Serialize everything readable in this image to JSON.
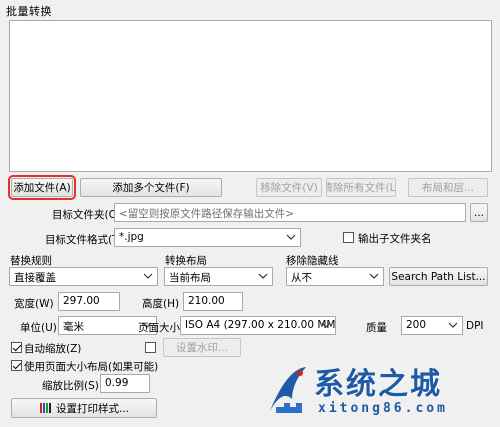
{
  "window": {
    "title": "批量转换"
  },
  "buttons": {
    "add_file": "添加文件(A)",
    "add_multiple": "添加多个文件(F)",
    "remove_file": "移除文件(V)",
    "clear_all": "清除所有文件(L)",
    "layout_layers": "布局和层...",
    "browse": "...",
    "search_path_list": "Search Path List...",
    "set_watermark": "设置水印...",
    "print_style": "设置打印样式..."
  },
  "target_folder": {
    "label": "目标文件夹(O)",
    "placeholder": "<留空则按原文件路径保存输出文件>"
  },
  "target_format": {
    "label": "目标文件格式(T)",
    "value": "*.jpg"
  },
  "output_subfolder": {
    "label": "输出子文件夹名",
    "checked": false
  },
  "replace_rule": {
    "label": "替换规则",
    "value": "直接覆盖"
  },
  "convert_layout": {
    "label": "转换布局",
    "value": "当前布局"
  },
  "remove_hidden": {
    "label": "移除隐藏线",
    "value": "从不"
  },
  "width": {
    "label": "宽度(W)",
    "value": "297.00"
  },
  "height": {
    "label": "高度(H)",
    "value": "210.00"
  },
  "unit": {
    "label": "单位(U)",
    "value": "毫米"
  },
  "page_size": {
    "label": "页面大小",
    "value": "ISO A4 (297.00 x 210.00 MM)"
  },
  "quality": {
    "label": "质量",
    "value": "200",
    "unit": "DPI"
  },
  "auto_zoom": {
    "label": "自动缩放(Z)",
    "checked": true
  },
  "watermark_check": {
    "checked": false
  },
  "use_page_layout": {
    "label": "使用页面大小布局(如果可能)",
    "checked": true
  },
  "scale": {
    "label": "缩放比例(S)",
    "value": "0.99"
  },
  "watermark_logo": {
    "text": "系统之城",
    "sub": "xitong86.com"
  }
}
